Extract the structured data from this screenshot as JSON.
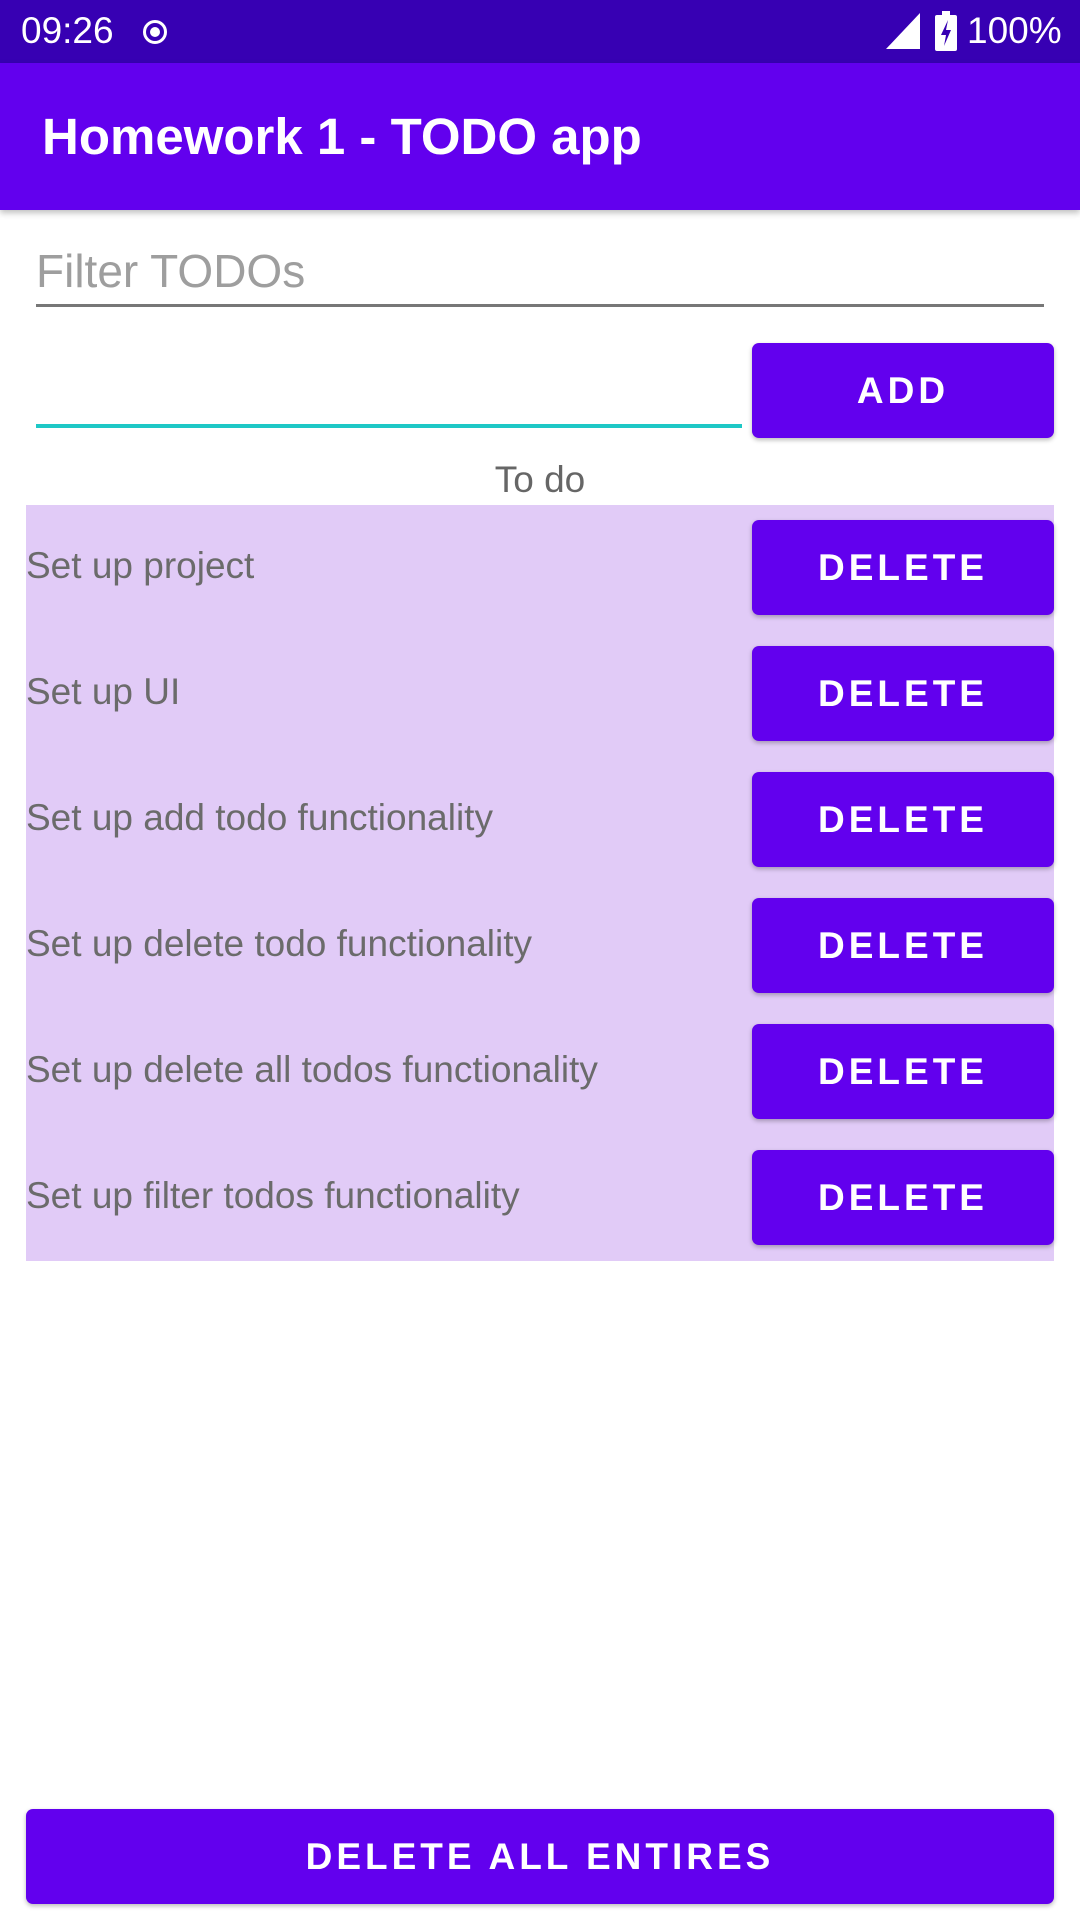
{
  "status_bar": {
    "time": "09:26",
    "battery": "100%",
    "icons": [
      "record-dot-icon",
      "signal-icon",
      "battery-charging-icon"
    ]
  },
  "app_bar": {
    "title": "Homework 1 - TODO app"
  },
  "filter": {
    "placeholder": "Filter TODOs",
    "value": ""
  },
  "new_todo": {
    "value": "",
    "add_label": "ADD"
  },
  "list": {
    "heading": "To do",
    "items": [
      {
        "text": "Set up project",
        "delete_label": "DELETE"
      },
      {
        "text": "Set up UI",
        "delete_label": "DELETE"
      },
      {
        "text": "Set up add todo functionality",
        "delete_label": "DELETE"
      },
      {
        "text": "Set up delete todo functionality",
        "delete_label": "DELETE"
      },
      {
        "text": "Set up delete all todos functionality",
        "delete_label": "DELETE"
      },
      {
        "text": "Set up filter todos functionality",
        "delete_label": "DELETE"
      }
    ]
  },
  "footer": {
    "delete_all_label": "DELETE ALL ENTIRES"
  },
  "colors": {
    "status_bar": "#3700b3",
    "primary": "#6200ee",
    "list_background": "#e1cbf7",
    "input_focus": "#1ec8c6"
  }
}
